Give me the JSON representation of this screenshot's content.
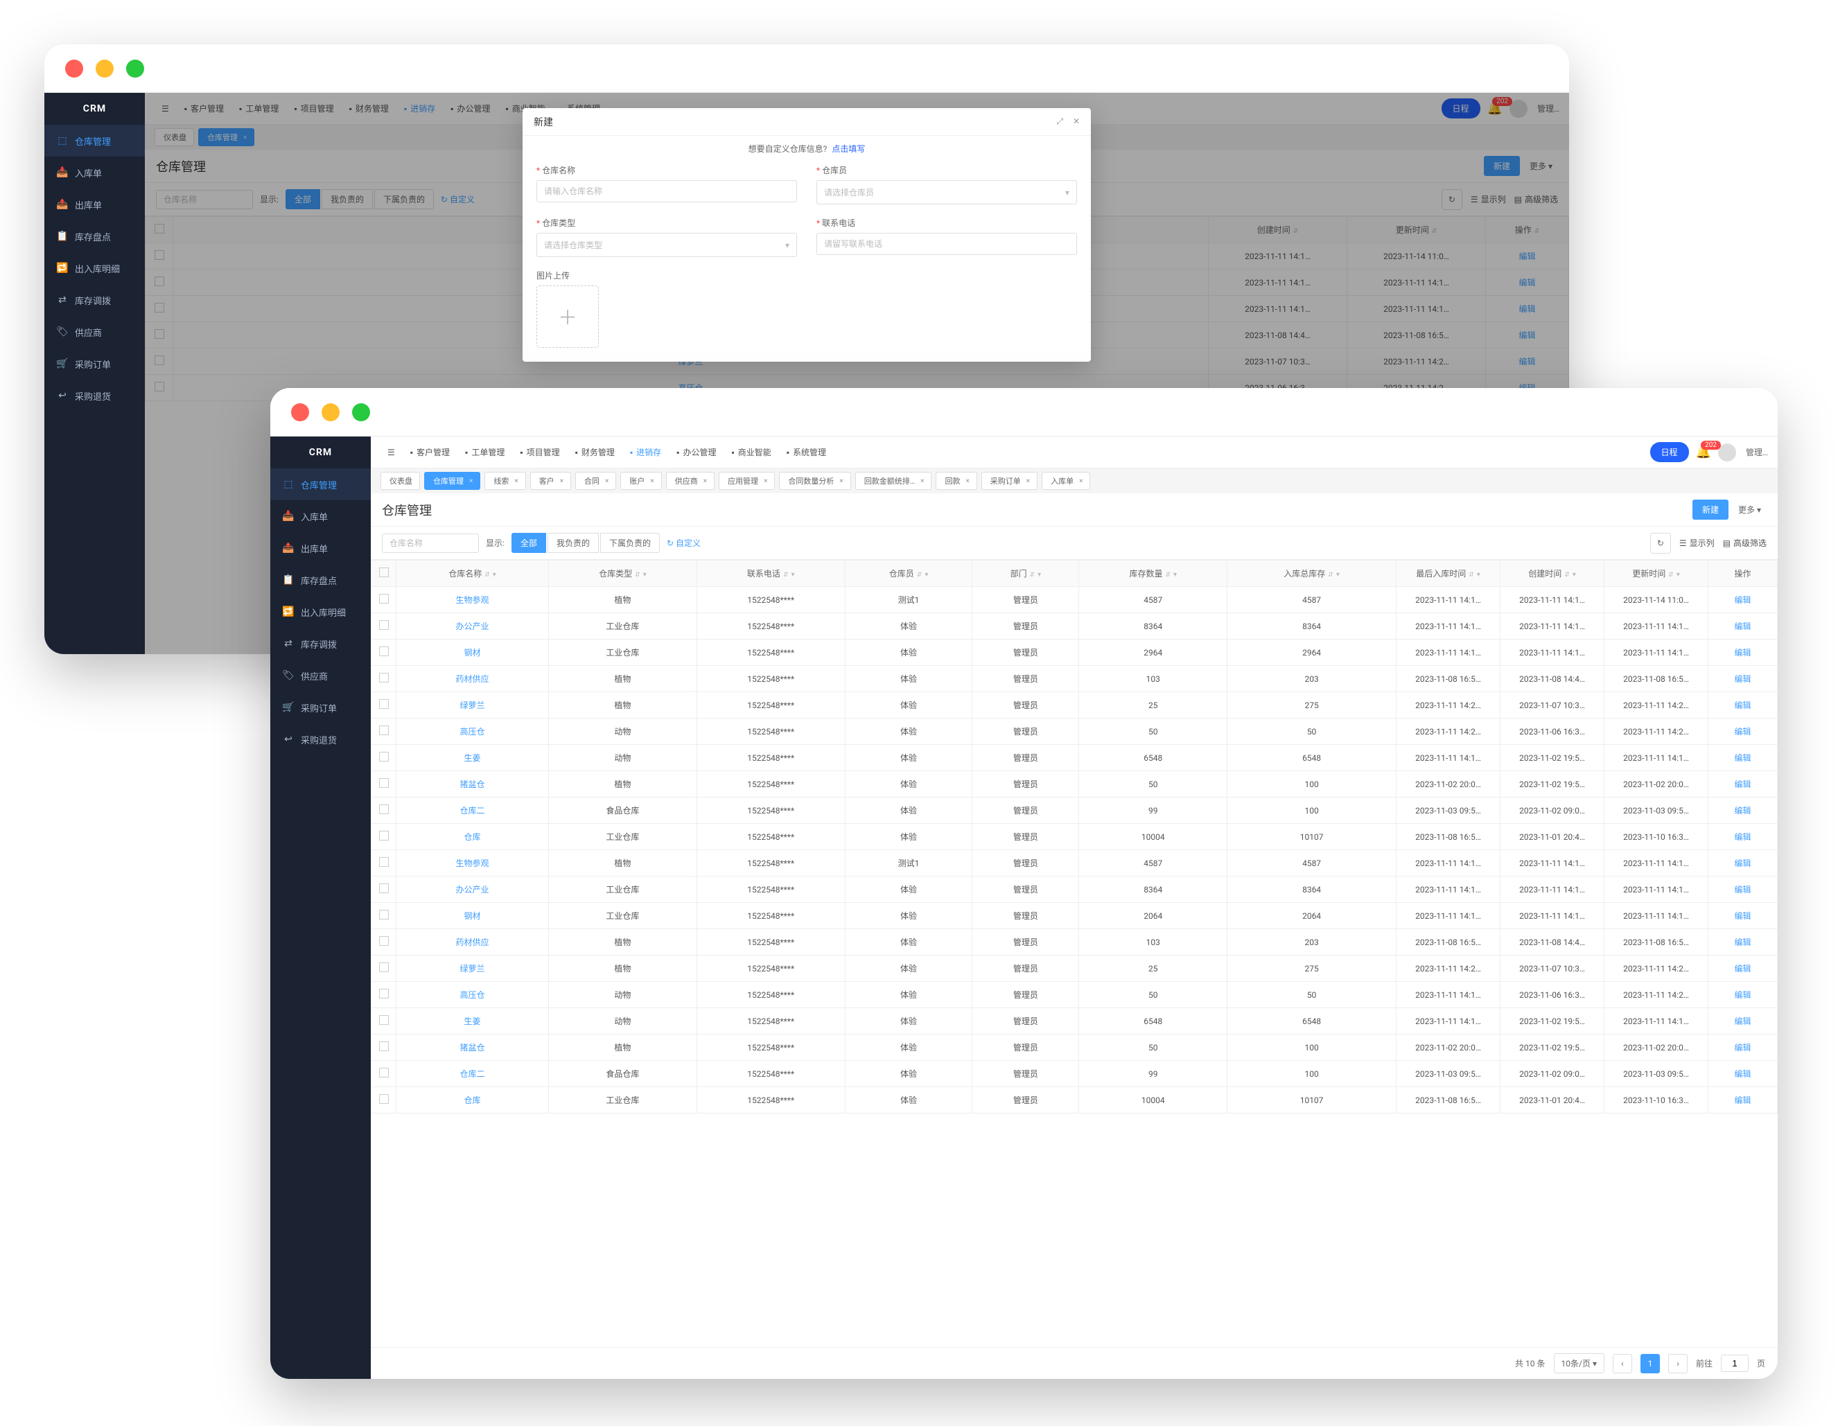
{
  "brand": "CRM",
  "sidebar": {
    "items": [
      {
        "label": "仓库管理",
        "active": true,
        "icon": "⬚"
      },
      {
        "label": "入库单",
        "icon": "📥"
      },
      {
        "label": "出库单",
        "icon": "📤"
      },
      {
        "label": "库存盘点",
        "icon": "📋"
      },
      {
        "label": "出入库明细",
        "icon": "🔁"
      },
      {
        "label": "库存调拨",
        "icon": "⇄"
      },
      {
        "label": "供应商",
        "icon": "🏷"
      },
      {
        "label": "采购订单",
        "icon": "🛒"
      },
      {
        "label": "采购退货",
        "icon": "↩"
      }
    ]
  },
  "topnav": {
    "items": [
      {
        "label": "客户管理"
      },
      {
        "label": "工单管理"
      },
      {
        "label": "项目管理"
      },
      {
        "label": "财务管理"
      },
      {
        "label": "进销存",
        "active": true
      },
      {
        "label": "办公管理"
      },
      {
        "label": "商业智能"
      },
      {
        "label": "系统管理"
      }
    ],
    "control_label": "日程",
    "badge": "202",
    "user_label": "管理…"
  },
  "tabs_bar": {
    "home_label": "仪表盘",
    "front": [
      {
        "label": "仓库管理",
        "active": true
      },
      {
        "label": "线索"
      },
      {
        "label": "客户"
      },
      {
        "label": "合同"
      },
      {
        "label": "账户"
      },
      {
        "label": "供应商"
      },
      {
        "label": "应用管理"
      },
      {
        "label": "合同数量分析"
      },
      {
        "label": "回款金额统排…"
      },
      {
        "label": "回款"
      },
      {
        "label": "采购订单"
      },
      {
        "label": "入库单"
      }
    ],
    "back": [
      {
        "label": "仓库管理",
        "active": true
      }
    ]
  },
  "page": {
    "title": "仓库管理",
    "new_btn": "新建",
    "more_btn": "更多 ▾"
  },
  "filter": {
    "search_placeholder": "仓库名称",
    "show_label": "显示:",
    "seg": [
      "全部",
      "我负责的",
      "下属负责的"
    ],
    "custom_btn": "自定义",
    "cols_btn": "显示列",
    "adv_btn": "高级筛选",
    "refresh_icon": "↻"
  },
  "columns": [
    "",
    "仓库名称",
    "仓库类型",
    "联系电话",
    "仓库员",
    "部门",
    "库存数量",
    "入库总库存",
    "最后入库时间",
    "创建时间",
    "更新时间",
    "操作"
  ],
  "short_columns": [
    "",
    "仓库名称",
    "创建时间",
    "更新时间",
    "操作"
  ],
  "rows": [
    {
      "name": "生物参观",
      "type": "植物",
      "phone": "1522548****",
      "keeper": "测试1",
      "dept": "管理员",
      "qty": 4587,
      "intotal": 4587,
      "last": "2023-11-11 14:1…",
      "ctime": "2023-11-11 14:1…",
      "utime": "2023-11-14 11:0…",
      "op": "编辑"
    },
    {
      "name": "办公产业",
      "type": "工业仓库",
      "phone": "1522548****",
      "keeper": "体验",
      "dept": "管理员",
      "qty": 8364,
      "intotal": 8364,
      "last": "2023-11-11 14:1…",
      "ctime": "2023-11-11 14:1…",
      "utime": "2023-11-11 14:1…",
      "op": "编辑"
    },
    {
      "name": "钢材",
      "type": "工业仓库",
      "phone": "1522548****",
      "keeper": "体验",
      "dept": "管理员",
      "qty": 2964,
      "intotal": 2964,
      "last": "2023-11-11 14:1…",
      "ctime": "2023-11-11 14:1…",
      "utime": "2023-11-11 14:1…",
      "op": "编辑"
    },
    {
      "name": "药材供应",
      "type": "植物",
      "phone": "1522548****",
      "keeper": "体验",
      "dept": "管理员",
      "qty": 103,
      "intotal": 203,
      "last": "2023-11-08 16:5…",
      "ctime": "2023-11-08 14:4…",
      "utime": "2023-11-08 16:5…",
      "op": "编辑"
    },
    {
      "name": "绿萝兰",
      "type": "植物",
      "phone": "1522548****",
      "keeper": "体验",
      "dept": "管理员",
      "qty": 25,
      "intotal": 275,
      "last": "2023-11-11 14:2…",
      "ctime": "2023-11-07 10:3…",
      "utime": "2023-11-11 14:2…",
      "op": "编辑"
    },
    {
      "name": "高压仓",
      "type": "动物",
      "phone": "1522548****",
      "keeper": "体验",
      "dept": "管理员",
      "qty": 50,
      "intotal": 50,
      "last": "2023-11-11 14:2…",
      "ctime": "2023-11-06 16:3…",
      "utime": "2023-11-11 14:2…",
      "op": "编辑"
    },
    {
      "name": "生姜",
      "type": "动物",
      "phone": "1522548****",
      "keeper": "体验",
      "dept": "管理员",
      "qty": 6548,
      "intotal": 6548,
      "last": "2023-11-11 14:1…",
      "ctime": "2023-11-02 19:5…",
      "utime": "2023-11-11 14:1…",
      "op": "编辑"
    },
    {
      "name": "猪盆仓",
      "type": "植物",
      "phone": "1522548****",
      "keeper": "体验",
      "dept": "管理员",
      "qty": 50,
      "intotal": 100,
      "last": "2023-11-02 20:0…",
      "ctime": "2023-11-02 19:5…",
      "utime": "2023-11-02 20:0…",
      "op": "编辑"
    },
    {
      "name": "仓库二",
      "type": "食品仓库",
      "phone": "1522548****",
      "keeper": "体验",
      "dept": "管理员",
      "qty": 99,
      "intotal": 100,
      "last": "2023-11-03 09:5…",
      "ctime": "2023-11-02 09:0…",
      "utime": "2023-11-03 09:5…",
      "op": "编辑"
    },
    {
      "name": "仓库",
      "type": "工业仓库",
      "phone": "1522548****",
      "keeper": "体验",
      "dept": "管理员",
      "qty": 10004,
      "intotal": 10107,
      "last": "2023-11-08 16:5…",
      "ctime": "2023-11-01 20:4…",
      "utime": "2023-11-10 16:3…",
      "op": "编辑"
    },
    {
      "name": "生物参观",
      "type": "植物",
      "phone": "1522548****",
      "keeper": "测试1",
      "dept": "管理员",
      "qty": 4587,
      "intotal": 4587,
      "last": "2023-11-11 14:1…",
      "ctime": "2023-11-11 14:1…",
      "utime": "2023-11-11 14:1…",
      "op": "编辑"
    },
    {
      "name": "办公产业",
      "type": "工业仓库",
      "phone": "1522548****",
      "keeper": "体验",
      "dept": "管理员",
      "qty": 8364,
      "intotal": 8364,
      "last": "2023-11-11 14:1…",
      "ctime": "2023-11-11 14:1…",
      "utime": "2023-11-11 14:1…",
      "op": "编辑"
    },
    {
      "name": "钢材",
      "type": "工业仓库",
      "phone": "1522548****",
      "keeper": "体验",
      "dept": "管理员",
      "qty": 2064,
      "intotal": 2064,
      "last": "2023-11-11 14:1…",
      "ctime": "2023-11-11 14:1…",
      "utime": "2023-11-11 14:1…",
      "op": "编辑"
    },
    {
      "name": "药材供应",
      "type": "植物",
      "phone": "1522548****",
      "keeper": "体验",
      "dept": "管理员",
      "qty": 103,
      "intotal": 203,
      "last": "2023-11-08 16:5…",
      "ctime": "2023-11-08 14:4…",
      "utime": "2023-11-08 16:5…",
      "op": "编辑"
    },
    {
      "name": "绿萝兰",
      "type": "植物",
      "phone": "1522548****",
      "keeper": "体验",
      "dept": "管理员",
      "qty": 25,
      "intotal": 275,
      "last": "2023-11-11 14:2…",
      "ctime": "2023-11-07 10:3…",
      "utime": "2023-11-11 14:2…",
      "op": "编辑"
    },
    {
      "name": "高压仓",
      "type": "动物",
      "phone": "1522548****",
      "keeper": "体验",
      "dept": "管理员",
      "qty": 50,
      "intotal": 50,
      "last": "2023-11-11 14:1…",
      "ctime": "2023-11-06 16:3…",
      "utime": "2023-11-11 14:2…",
      "op": "编辑"
    },
    {
      "name": "生姜",
      "type": "动物",
      "phone": "1522548****",
      "keeper": "体验",
      "dept": "管理员",
      "qty": 6548,
      "intotal": 6548,
      "last": "2023-11-11 14:1…",
      "ctime": "2023-11-02 19:5…",
      "utime": "2023-11-11 14:1…",
      "op": "编辑"
    },
    {
      "name": "猪盆仓",
      "type": "植物",
      "phone": "1522548****",
      "keeper": "体验",
      "dept": "管理员",
      "qty": 50,
      "intotal": 100,
      "last": "2023-11-02 20:0…",
      "ctime": "2023-11-02 19:5…",
      "utime": "2023-11-02 20:0…",
      "op": "编辑"
    },
    {
      "name": "仓库二",
      "type": "食品仓库",
      "phone": "1522548****",
      "keeper": "体验",
      "dept": "管理员",
      "qty": 99,
      "intotal": 100,
      "last": "2023-11-03 09:5…",
      "ctime": "2023-11-02 09:0…",
      "utime": "2023-11-03 09:5…",
      "op": "编辑"
    },
    {
      "name": "仓库",
      "type": "工业仓库",
      "phone": "1522548****",
      "keeper": "体验",
      "dept": "管理员",
      "qty": 10004,
      "intotal": 10107,
      "last": "2023-11-08 16:5…",
      "ctime": "2023-11-01 20:4…",
      "utime": "2023-11-10 16:3…",
      "op": "编辑"
    }
  ],
  "pagination": {
    "total": "共 10 条",
    "size": "10条/页",
    "prev": "‹",
    "page": "1",
    "next": "›",
    "goto_label": "前往",
    "goto_value": "1",
    "unit": "页"
  },
  "modal": {
    "title": "新建",
    "expand_icon": "⤢",
    "close_icon": "✕",
    "tip_text": "想要自定义仓库信息?",
    "tip_link": "点击填写",
    "fields": {
      "name_label": "仓库名称",
      "name_placeholder": "请输入仓库名称",
      "keeper_label": "仓库员",
      "keeper_placeholder": "请选择仓库员",
      "type_label": "仓库类型",
      "type_placeholder": "请选择仓库类型",
      "phone_label": "联系电话",
      "phone_placeholder": "请留写联系电话",
      "upload_label": "图片上传"
    }
  }
}
